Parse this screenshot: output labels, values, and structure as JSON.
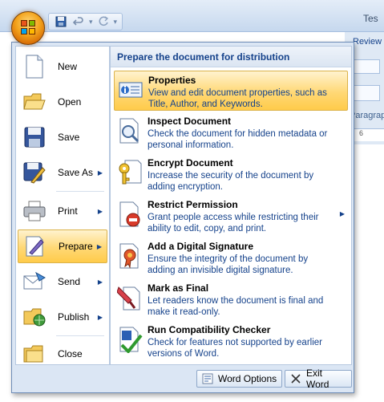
{
  "window": {
    "title_fragment": "Tes"
  },
  "quick_access": {
    "save_icon": "save-icon",
    "undo_icon": "undo-icon",
    "redo_icon": "redo-icon",
    "customize_icon": "customize-qat-icon"
  },
  "ribbon": {
    "review_tab": "Review",
    "paragraph_group": "Paragraph",
    "ruler_mark": "6"
  },
  "left_menu": {
    "items": [
      {
        "label": "New",
        "icon": "new-document-icon",
        "has_submenu": false
      },
      {
        "label": "Open",
        "icon": "open-folder-icon",
        "has_submenu": false
      },
      {
        "label": "Save",
        "icon": "save-disk-icon",
        "has_submenu": false
      },
      {
        "label": "Save As",
        "icon": "save-as-icon",
        "has_submenu": true
      },
      {
        "label": "Print",
        "icon": "printer-icon",
        "has_submenu": true
      },
      {
        "label": "Prepare",
        "icon": "prepare-icon",
        "has_submenu": true,
        "active": true
      },
      {
        "label": "Send",
        "icon": "send-icon",
        "has_submenu": true
      },
      {
        "label": "Publish",
        "icon": "publish-icon",
        "has_submenu": true
      },
      {
        "label": "Close",
        "icon": "close-folder-icon",
        "has_submenu": false
      }
    ]
  },
  "submenu": {
    "header": "Prepare the document for distribution",
    "items": [
      {
        "title": "Properties",
        "description": "View and edit document properties, such as Title, Author, and Keywords.",
        "icon": "properties-icon",
        "active": true
      },
      {
        "title": "Inspect Document",
        "description": "Check the document for hidden metadata or personal information.",
        "icon": "inspect-document-icon"
      },
      {
        "title": "Encrypt Document",
        "description": "Increase the security of the document by adding encryption.",
        "icon": "encrypt-key-icon"
      },
      {
        "title": "Restrict Permission",
        "description": "Grant people access while restricting their ability to edit, copy, and print.",
        "icon": "restrict-permission-icon",
        "has_submenu": true
      },
      {
        "title": "Add a Digital Signature",
        "description": "Ensure the integrity of the document by adding an invisible digital signature.",
        "icon": "digital-signature-icon"
      },
      {
        "title": "Mark as Final",
        "description": "Let readers know the document is final and make it read-only.",
        "icon": "mark-final-icon"
      },
      {
        "title": "Run Compatibility Checker",
        "description": "Check for features not supported by earlier versions of Word.",
        "icon": "compatibility-checker-icon"
      }
    ]
  },
  "footer": {
    "options_label": "Word Options",
    "exit_label": "Exit Word"
  }
}
